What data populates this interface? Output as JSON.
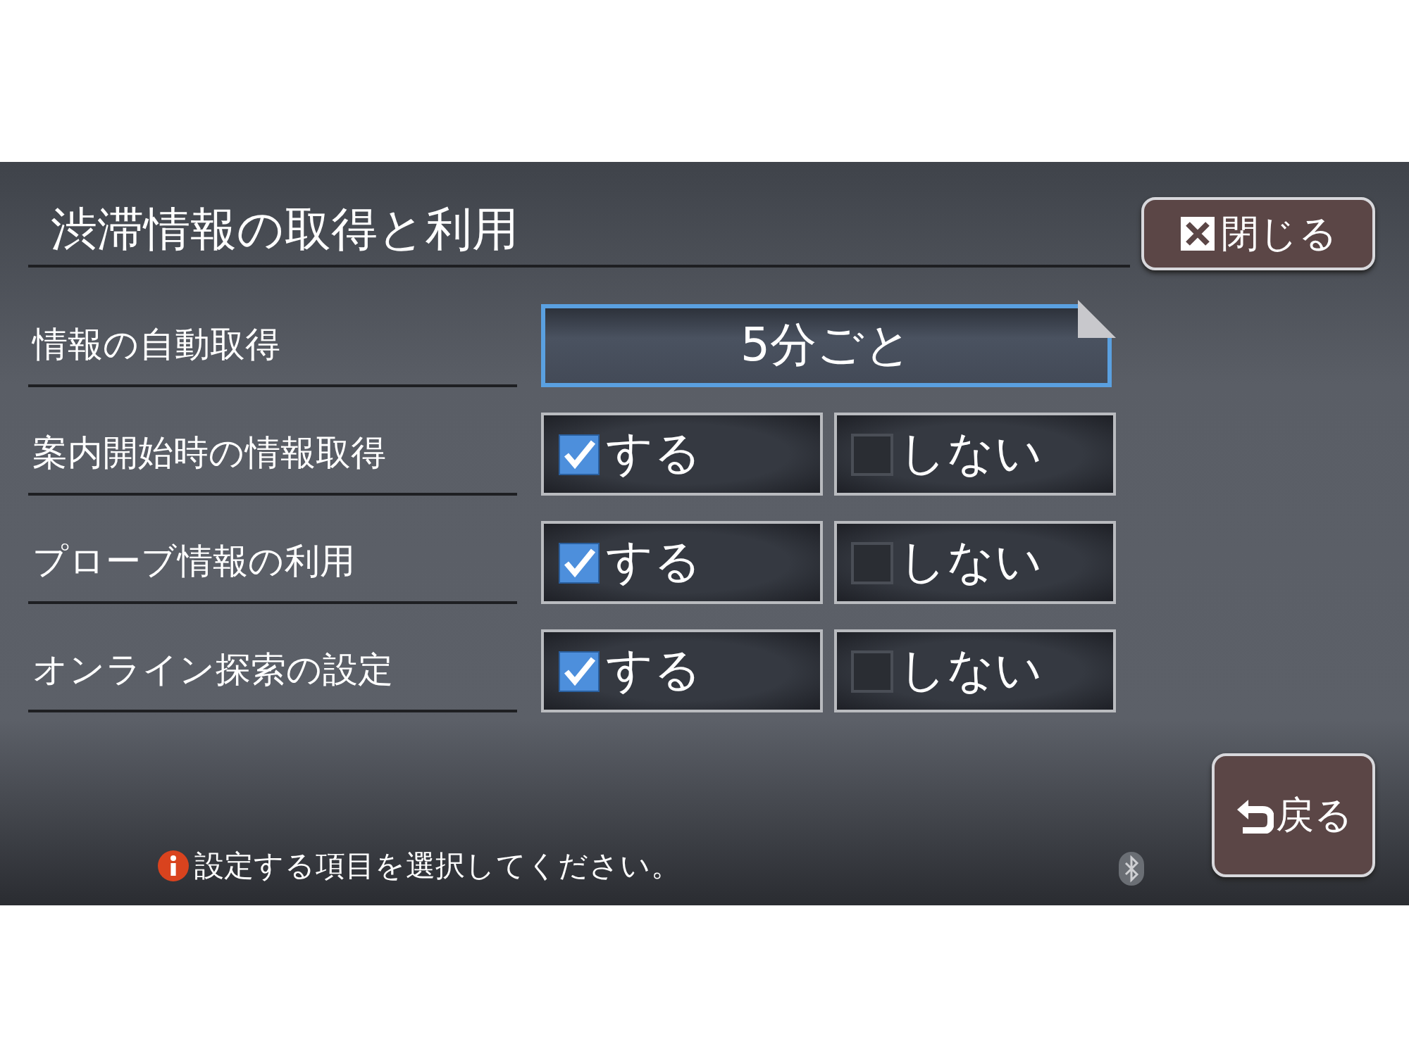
{
  "title": "渋滞情報の取得と利用",
  "close_button": {
    "label": "閉じる"
  },
  "settings": [
    {
      "kind": "dropdown",
      "label": "情報の自動取得",
      "value": "5分ごと"
    },
    {
      "kind": "toggle",
      "label": "案内開始時の情報取得",
      "options": [
        {
          "label": "する",
          "checked": true
        },
        {
          "label": "しない",
          "checked": false
        }
      ]
    },
    {
      "kind": "toggle",
      "label": "プローブ情報の利用",
      "options": [
        {
          "label": "する",
          "checked": true
        },
        {
          "label": "しない",
          "checked": false
        }
      ]
    },
    {
      "kind": "toggle",
      "label": "オンライン探索の設定",
      "options": [
        {
          "label": "する",
          "checked": true
        },
        {
          "label": "しない",
          "checked": false
        }
      ]
    }
  ],
  "back_button": {
    "label": "戻る"
  },
  "status_message": "設定する項目を選択してください。"
}
